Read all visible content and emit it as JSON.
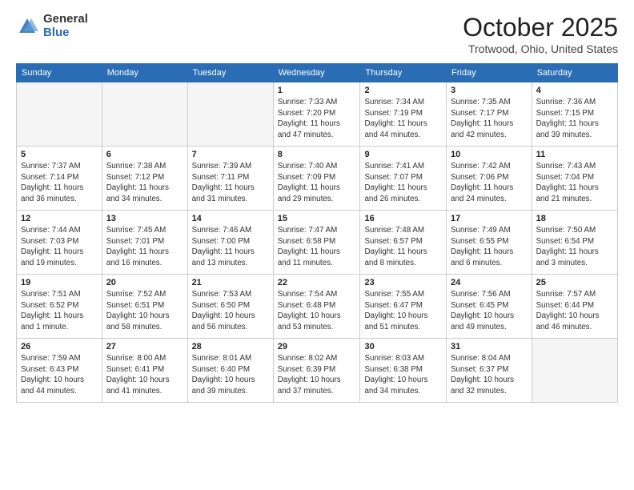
{
  "logo": {
    "general": "General",
    "blue": "Blue"
  },
  "header": {
    "month": "October 2025",
    "location": "Trotwood, Ohio, United States"
  },
  "weekdays": [
    "Sunday",
    "Monday",
    "Tuesday",
    "Wednesday",
    "Thursday",
    "Friday",
    "Saturday"
  ],
  "weeks": [
    [
      {
        "day": "",
        "info": ""
      },
      {
        "day": "",
        "info": ""
      },
      {
        "day": "",
        "info": ""
      },
      {
        "day": "1",
        "info": "Sunrise: 7:33 AM\nSunset: 7:20 PM\nDaylight: 11 hours\nand 47 minutes."
      },
      {
        "day": "2",
        "info": "Sunrise: 7:34 AM\nSunset: 7:19 PM\nDaylight: 11 hours\nand 44 minutes."
      },
      {
        "day": "3",
        "info": "Sunrise: 7:35 AM\nSunset: 7:17 PM\nDaylight: 11 hours\nand 42 minutes."
      },
      {
        "day": "4",
        "info": "Sunrise: 7:36 AM\nSunset: 7:15 PM\nDaylight: 11 hours\nand 39 minutes."
      }
    ],
    [
      {
        "day": "5",
        "info": "Sunrise: 7:37 AM\nSunset: 7:14 PM\nDaylight: 11 hours\nand 36 minutes."
      },
      {
        "day": "6",
        "info": "Sunrise: 7:38 AM\nSunset: 7:12 PM\nDaylight: 11 hours\nand 34 minutes."
      },
      {
        "day": "7",
        "info": "Sunrise: 7:39 AM\nSunset: 7:11 PM\nDaylight: 11 hours\nand 31 minutes."
      },
      {
        "day": "8",
        "info": "Sunrise: 7:40 AM\nSunset: 7:09 PM\nDaylight: 11 hours\nand 29 minutes."
      },
      {
        "day": "9",
        "info": "Sunrise: 7:41 AM\nSunset: 7:07 PM\nDaylight: 11 hours\nand 26 minutes."
      },
      {
        "day": "10",
        "info": "Sunrise: 7:42 AM\nSunset: 7:06 PM\nDaylight: 11 hours\nand 24 minutes."
      },
      {
        "day": "11",
        "info": "Sunrise: 7:43 AM\nSunset: 7:04 PM\nDaylight: 11 hours\nand 21 minutes."
      }
    ],
    [
      {
        "day": "12",
        "info": "Sunrise: 7:44 AM\nSunset: 7:03 PM\nDaylight: 11 hours\nand 19 minutes."
      },
      {
        "day": "13",
        "info": "Sunrise: 7:45 AM\nSunset: 7:01 PM\nDaylight: 11 hours\nand 16 minutes."
      },
      {
        "day": "14",
        "info": "Sunrise: 7:46 AM\nSunset: 7:00 PM\nDaylight: 11 hours\nand 13 minutes."
      },
      {
        "day": "15",
        "info": "Sunrise: 7:47 AM\nSunset: 6:58 PM\nDaylight: 11 hours\nand 11 minutes."
      },
      {
        "day": "16",
        "info": "Sunrise: 7:48 AM\nSunset: 6:57 PM\nDaylight: 11 hours\nand 8 minutes."
      },
      {
        "day": "17",
        "info": "Sunrise: 7:49 AM\nSunset: 6:55 PM\nDaylight: 11 hours\nand 6 minutes."
      },
      {
        "day": "18",
        "info": "Sunrise: 7:50 AM\nSunset: 6:54 PM\nDaylight: 11 hours\nand 3 minutes."
      }
    ],
    [
      {
        "day": "19",
        "info": "Sunrise: 7:51 AM\nSunset: 6:52 PM\nDaylight: 11 hours\nand 1 minute."
      },
      {
        "day": "20",
        "info": "Sunrise: 7:52 AM\nSunset: 6:51 PM\nDaylight: 10 hours\nand 58 minutes."
      },
      {
        "day": "21",
        "info": "Sunrise: 7:53 AM\nSunset: 6:50 PM\nDaylight: 10 hours\nand 56 minutes."
      },
      {
        "day": "22",
        "info": "Sunrise: 7:54 AM\nSunset: 6:48 PM\nDaylight: 10 hours\nand 53 minutes."
      },
      {
        "day": "23",
        "info": "Sunrise: 7:55 AM\nSunset: 6:47 PM\nDaylight: 10 hours\nand 51 minutes."
      },
      {
        "day": "24",
        "info": "Sunrise: 7:56 AM\nSunset: 6:45 PM\nDaylight: 10 hours\nand 49 minutes."
      },
      {
        "day": "25",
        "info": "Sunrise: 7:57 AM\nSunset: 6:44 PM\nDaylight: 10 hours\nand 46 minutes."
      }
    ],
    [
      {
        "day": "26",
        "info": "Sunrise: 7:59 AM\nSunset: 6:43 PM\nDaylight: 10 hours\nand 44 minutes."
      },
      {
        "day": "27",
        "info": "Sunrise: 8:00 AM\nSunset: 6:41 PM\nDaylight: 10 hours\nand 41 minutes."
      },
      {
        "day": "28",
        "info": "Sunrise: 8:01 AM\nSunset: 6:40 PM\nDaylight: 10 hours\nand 39 minutes."
      },
      {
        "day": "29",
        "info": "Sunrise: 8:02 AM\nSunset: 6:39 PM\nDaylight: 10 hours\nand 37 minutes."
      },
      {
        "day": "30",
        "info": "Sunrise: 8:03 AM\nSunset: 6:38 PM\nDaylight: 10 hours\nand 34 minutes."
      },
      {
        "day": "31",
        "info": "Sunrise: 8:04 AM\nSunset: 6:37 PM\nDaylight: 10 hours\nand 32 minutes."
      },
      {
        "day": "",
        "info": ""
      }
    ]
  ]
}
